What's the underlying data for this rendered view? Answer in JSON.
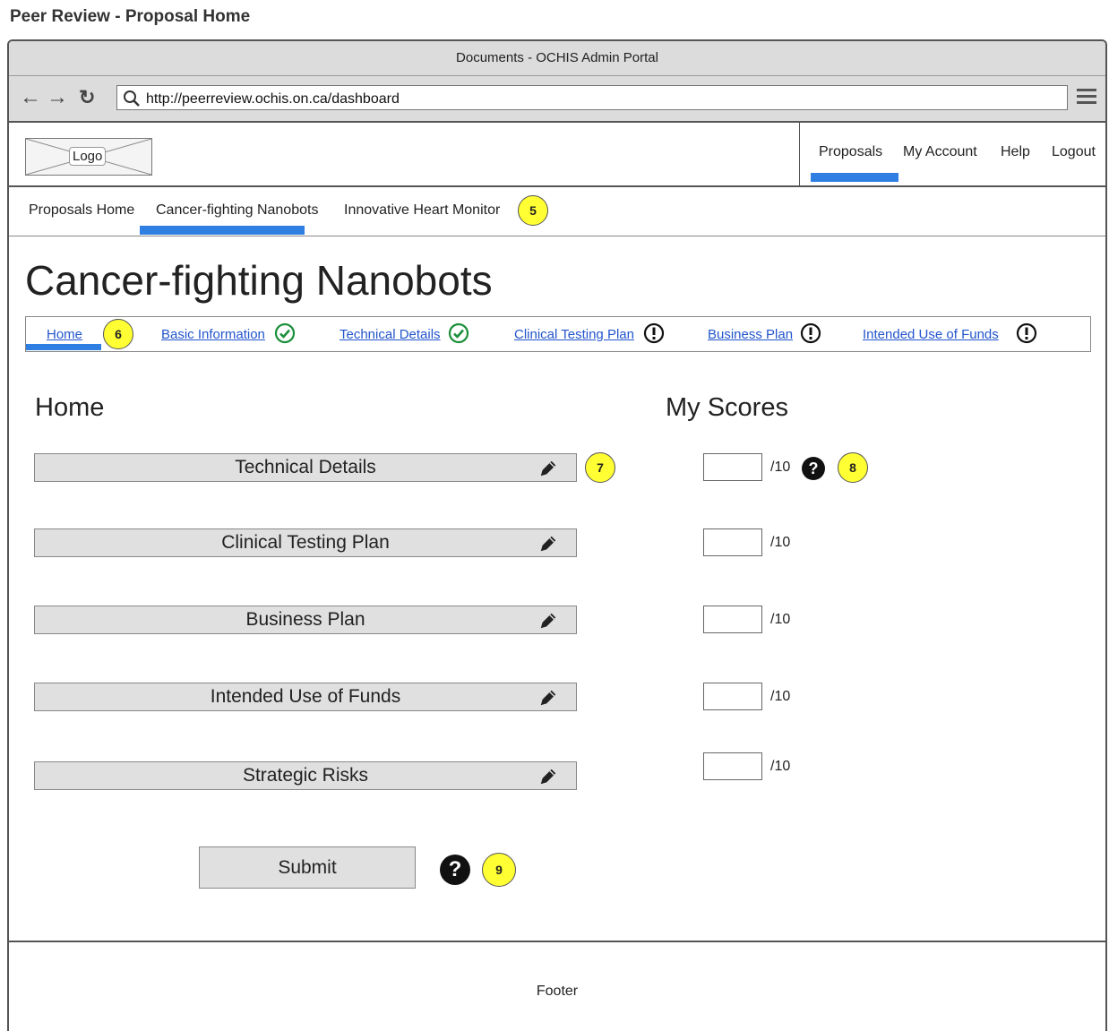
{
  "page_title": "Peer Review - Proposal Home",
  "browser": {
    "window_title": "Documents - OCHIS Admin Portal",
    "url": "http://peerreview.ochis.on.ca/dashboard"
  },
  "header": {
    "logo_label": "Logo",
    "nav": [
      {
        "label": "Proposals",
        "active": true
      },
      {
        "label": "My Account"
      },
      {
        "label": "Help"
      },
      {
        "label": "Logout"
      }
    ]
  },
  "tabs": [
    {
      "label": "Proposals Home"
    },
    {
      "label": "Cancer-fighting Nanobots",
      "active": true
    },
    {
      "label": "Innovative Heart Monitor"
    }
  ],
  "callouts": [
    "5",
    "6",
    "7",
    "8",
    "9"
  ],
  "proposal_title": "Cancer-fighting Nanobots",
  "subnav": [
    {
      "label": "Home",
      "active": true
    },
    {
      "label": "Basic Information",
      "status": "complete"
    },
    {
      "label": "Technical Details",
      "status": "complete"
    },
    {
      "label": "Clinical Testing Plan",
      "status": "attention"
    },
    {
      "label": "Business Plan",
      "status": "attention"
    },
    {
      "label": "Intended Use of Funds",
      "status": "attention"
    }
  ],
  "home": {
    "heading": "Home",
    "sections": [
      {
        "label": "Technical Details",
        "icon": "pencil-icon"
      },
      {
        "label": "Clinical Testing Plan",
        "icon": "pencil-icon"
      },
      {
        "label": "Business Plan",
        "icon": "pencil-icon"
      },
      {
        "label": "Intended Use of Funds",
        "icon": "pencil-icon"
      },
      {
        "label": "Strategic Risks",
        "icon": "pencil-icon"
      }
    ]
  },
  "scores": {
    "heading": "My Scores",
    "max_label": "/10",
    "values": [
      "",
      "",
      "",
      "",
      ""
    ]
  },
  "submit_label": "Submit",
  "footer_text": "Footer",
  "colors": {
    "accent": "#2f7fe3",
    "callout": "#ffff33",
    "complete": "#1a8f3a",
    "link": "#2255cc"
  }
}
